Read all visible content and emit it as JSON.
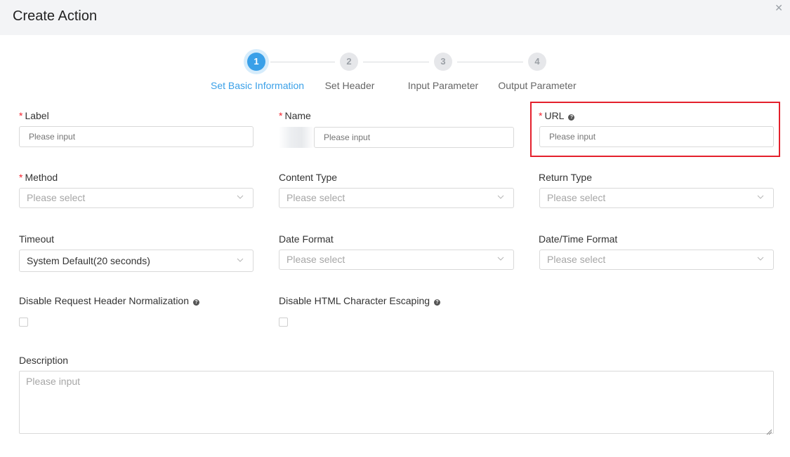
{
  "dialog": {
    "title": "Create Action",
    "close_icon": "close-icon"
  },
  "steps": [
    {
      "number": "1",
      "label": "Set Basic Information",
      "active": true
    },
    {
      "number": "2",
      "label": "Set Header",
      "active": false
    },
    {
      "number": "3",
      "label": "Input Parameter",
      "active": false
    },
    {
      "number": "4",
      "label": "Output Parameter",
      "active": false
    }
  ],
  "form": {
    "label": {
      "label": "Label",
      "required_mark": "*",
      "placeholder": "Please input",
      "value": ""
    },
    "name": {
      "label": "Name",
      "required_mark": "*",
      "placeholder": "Please input",
      "value": ""
    },
    "url": {
      "label": "URL",
      "required_mark": "*",
      "placeholder": "Please input",
      "value": ""
    },
    "method": {
      "label": "Method",
      "required_mark": "*",
      "placeholder": "Please select"
    },
    "content_type": {
      "label": "Content Type",
      "placeholder": "Please select"
    },
    "return_type": {
      "label": "Return Type",
      "placeholder": "Please select"
    },
    "timeout": {
      "label": "Timeout",
      "value": "System Default(20 seconds)"
    },
    "date_format": {
      "label": "Date Format",
      "placeholder": "Please select"
    },
    "datetime_format": {
      "label": "Date/Time Format",
      "placeholder": "Please select"
    },
    "disable_header_normalization": {
      "label": "Disable Request Header Normalization",
      "checked": false
    },
    "disable_html_escaping": {
      "label": "Disable HTML Character Escaping",
      "checked": false
    },
    "description": {
      "label": "Description",
      "placeholder": "Please input"
    }
  },
  "colors": {
    "accent": "#3aa0e8",
    "required": "#f5222d",
    "highlight": "#e4202c",
    "header_bg": "#f3f4f6"
  }
}
